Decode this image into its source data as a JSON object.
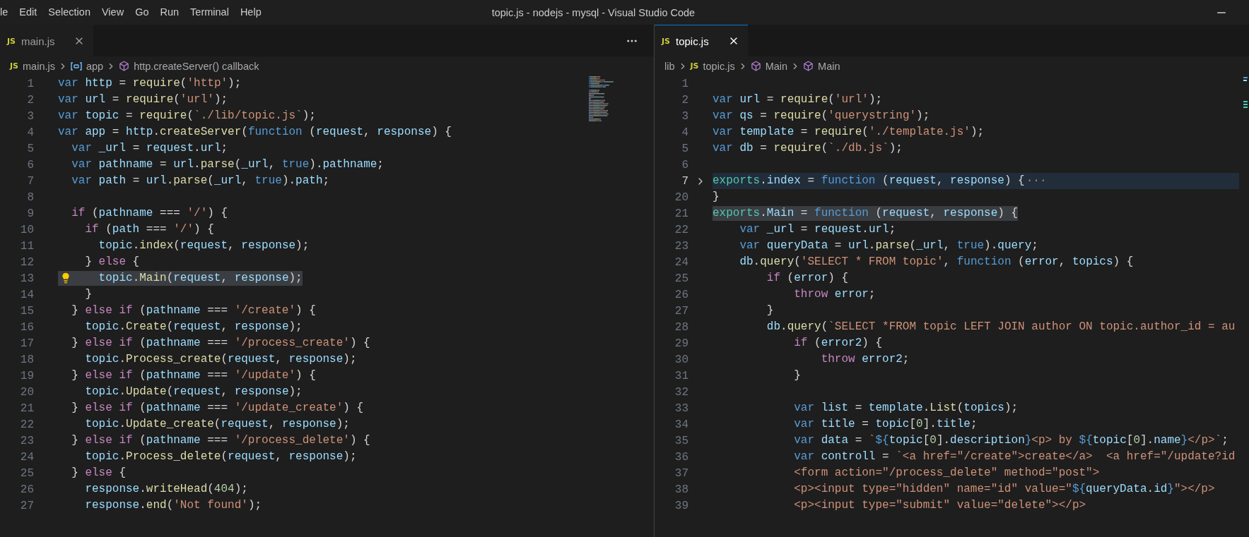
{
  "window": {
    "title": "topic.js - nodejs - mysql - Visual Studio Code"
  },
  "menu": [
    "le",
    "Edit",
    "Selection",
    "View",
    "Go",
    "Run",
    "Terminal",
    "Help"
  ],
  "panes": [
    {
      "focused": false,
      "more_actions": true,
      "tabs": [
        {
          "badge": "JS",
          "label": "main.js",
          "selected": true
        }
      ],
      "breadcrumbs": [
        {
          "kind": "file",
          "badge": "JS",
          "label": "main.js"
        },
        {
          "kind": "variable",
          "label": "app"
        },
        {
          "kind": "method",
          "label": "http.createServer() callback"
        }
      ],
      "minimap": true,
      "lines": [
        {
          "number": "1",
          "tokens": [
            {
              "kind": "keyword",
              "text": "var"
            },
            {
              "kind": "variable",
              "text": " http"
            },
            {
              "kind": "plain",
              "text": " = "
            },
            {
              "kind": "function",
              "text": "require"
            },
            {
              "kind": "plain",
              "text": "("
            },
            {
              "kind": "string",
              "text": "'http'"
            },
            {
              "kind": "plain",
              "text": ");"
            }
          ]
        },
        {
          "number": "2",
          "tokens": [
            {
              "kind": "keyword",
              "text": "var"
            },
            {
              "kind": "variable",
              "text": " url"
            },
            {
              "kind": "plain",
              "text": " = "
            },
            {
              "kind": "function",
              "text": "require"
            },
            {
              "kind": "plain",
              "text": "("
            },
            {
              "kind": "string",
              "text": "'url'"
            },
            {
              "kind": "plain",
              "text": ");"
            }
          ]
        },
        {
          "number": "3",
          "tokens": [
            {
              "kind": "keyword",
              "text": "var"
            },
            {
              "kind": "variable",
              "text": " topic"
            },
            {
              "kind": "plain",
              "text": " = "
            },
            {
              "kind": "function",
              "text": "require"
            },
            {
              "kind": "plain",
              "text": "("
            },
            {
              "kind": "string",
              "text": "`./lib/topic.js`"
            },
            {
              "kind": "plain",
              "text": ");"
            }
          ]
        },
        {
          "number": "4",
          "tokens": [
            {
              "kind": "keyword",
              "text": "var"
            },
            {
              "kind": "variable",
              "text": " app"
            },
            {
              "kind": "plain",
              "text": " = "
            },
            {
              "kind": "variable",
              "text": "http"
            },
            {
              "kind": "plain",
              "text": "."
            },
            {
              "kind": "function",
              "text": "createServer"
            },
            {
              "kind": "plain",
              "text": "("
            },
            {
              "kind": "keyword",
              "text": "function"
            },
            {
              "kind": "plain",
              "text": " ("
            },
            {
              "kind": "variable",
              "text": "request"
            },
            {
              "kind": "plain",
              "text": ", "
            },
            {
              "kind": "variable",
              "text": "response"
            },
            {
              "kind": "plain",
              "text": ") {"
            }
          ]
        },
        {
          "number": "5",
          "tokens": [
            {
              "kind": "keyword",
              "text": "  var"
            },
            {
              "kind": "variable",
              "text": " _url"
            },
            {
              "kind": "plain",
              "text": " = "
            },
            {
              "kind": "variable",
              "text": "request"
            },
            {
              "kind": "plain",
              "text": "."
            },
            {
              "kind": "variable",
              "text": "url"
            },
            {
              "kind": "plain",
              "text": ";"
            }
          ]
        },
        {
          "number": "6",
          "tokens": [
            {
              "kind": "keyword",
              "text": "  var"
            },
            {
              "kind": "variable",
              "text": " pathname"
            },
            {
              "kind": "plain",
              "text": " = "
            },
            {
              "kind": "variable",
              "text": "url"
            },
            {
              "kind": "plain",
              "text": "."
            },
            {
              "kind": "function",
              "text": "parse"
            },
            {
              "kind": "plain",
              "text": "("
            },
            {
              "kind": "variable",
              "text": "_url"
            },
            {
              "kind": "plain",
              "text": ", "
            },
            {
              "kind": "keyword",
              "text": "true"
            },
            {
              "kind": "plain",
              "text": ")."
            },
            {
              "kind": "variable",
              "text": "pathname"
            },
            {
              "kind": "plain",
              "text": ";"
            }
          ]
        },
        {
          "number": "7",
          "tokens": [
            {
              "kind": "keyword",
              "text": "  var"
            },
            {
              "kind": "variable",
              "text": " path"
            },
            {
              "kind": "plain",
              "text": " = "
            },
            {
              "kind": "variable",
              "text": "url"
            },
            {
              "kind": "plain",
              "text": "."
            },
            {
              "kind": "function",
              "text": "parse"
            },
            {
              "kind": "plain",
              "text": "("
            },
            {
              "kind": "variable",
              "text": "_url"
            },
            {
              "kind": "plain",
              "text": ", "
            },
            {
              "kind": "keyword",
              "text": "true"
            },
            {
              "kind": "plain",
              "text": ")."
            },
            {
              "kind": "variable",
              "text": "path"
            },
            {
              "kind": "plain",
              "text": ";"
            }
          ]
        },
        {
          "number": "8"
        },
        {
          "number": "9",
          "tokens": [
            {
              "kind": "control",
              "text": "  if"
            },
            {
              "kind": "plain",
              "text": " ("
            },
            {
              "kind": "variable",
              "text": "pathname"
            },
            {
              "kind": "plain",
              "text": " === "
            },
            {
              "kind": "string",
              "text": "'/'"
            },
            {
              "kind": "plain",
              "text": ") {"
            }
          ]
        },
        {
          "number": "10",
          "tokens": [
            {
              "kind": "control",
              "text": "    if"
            },
            {
              "kind": "plain",
              "text": " ("
            },
            {
              "kind": "variable",
              "text": "path"
            },
            {
              "kind": "plain",
              "text": " === "
            },
            {
              "kind": "string",
              "text": "'/'"
            },
            {
              "kind": "plain",
              "text": ") {"
            }
          ]
        },
        {
          "number": "11",
          "tokens": [
            {
              "kind": "variable",
              "text": "      topic"
            },
            {
              "kind": "plain",
              "text": "."
            },
            {
              "kind": "function",
              "text": "index"
            },
            {
              "kind": "plain",
              "text": "("
            },
            {
              "kind": "variable",
              "text": "request"
            },
            {
              "kind": "plain",
              "text": ", "
            },
            {
              "kind": "variable",
              "text": "response"
            },
            {
              "kind": "plain",
              "text": ");"
            }
          ]
        },
        {
          "number": "12",
          "tokens": [
            {
              "kind": "plain",
              "text": "    } "
            },
            {
              "kind": "control",
              "text": "else"
            },
            {
              "kind": "plain",
              "text": " {"
            }
          ]
        },
        {
          "number": "13",
          "selected_text": true,
          "lightbulb": true,
          "tokens": [
            {
              "kind": "variable",
              "text": "      topic"
            },
            {
              "kind": "plain",
              "text": "."
            },
            {
              "kind": "function",
              "text": "Main"
            },
            {
              "kind": "plain",
              "text": "("
            },
            {
              "kind": "variable",
              "text": "request"
            },
            {
              "kind": "plain",
              "text": ", "
            },
            {
              "kind": "variable",
              "text": "response"
            },
            {
              "kind": "plain",
              "text": ");"
            }
          ]
        },
        {
          "number": "14",
          "tokens": [
            {
              "kind": "plain",
              "text": "    }"
            }
          ]
        },
        {
          "number": "15",
          "tokens": [
            {
              "kind": "plain",
              "text": "  } "
            },
            {
              "kind": "control",
              "text": "else if"
            },
            {
              "kind": "plain",
              "text": " ("
            },
            {
              "kind": "variable",
              "text": "pathname"
            },
            {
              "kind": "plain",
              "text": " === "
            },
            {
              "kind": "string",
              "text": "'/create'"
            },
            {
              "kind": "plain",
              "text": ") {"
            }
          ]
        },
        {
          "number": "16",
          "tokens": [
            {
              "kind": "variable",
              "text": "    topic"
            },
            {
              "kind": "plain",
              "text": "."
            },
            {
              "kind": "function",
              "text": "Create"
            },
            {
              "kind": "plain",
              "text": "("
            },
            {
              "kind": "variable",
              "text": "request"
            },
            {
              "kind": "plain",
              "text": ", "
            },
            {
              "kind": "variable",
              "text": "response"
            },
            {
              "kind": "plain",
              "text": ");"
            }
          ]
        },
        {
          "number": "17",
          "tokens": [
            {
              "kind": "plain",
              "text": "  } "
            },
            {
              "kind": "control",
              "text": "else if"
            },
            {
              "kind": "plain",
              "text": " ("
            },
            {
              "kind": "variable",
              "text": "pathname"
            },
            {
              "kind": "plain",
              "text": " === "
            },
            {
              "kind": "string",
              "text": "'/process_create'"
            },
            {
              "kind": "plain",
              "text": ") {"
            }
          ]
        },
        {
          "number": "18",
          "tokens": [
            {
              "kind": "variable",
              "text": "    topic"
            },
            {
              "kind": "plain",
              "text": "."
            },
            {
              "kind": "function",
              "text": "Process_create"
            },
            {
              "kind": "plain",
              "text": "("
            },
            {
              "kind": "variable",
              "text": "request"
            },
            {
              "kind": "plain",
              "text": ", "
            },
            {
              "kind": "variable",
              "text": "response"
            },
            {
              "kind": "plain",
              "text": ");"
            }
          ]
        },
        {
          "number": "19",
          "tokens": [
            {
              "kind": "plain",
              "text": "  } "
            },
            {
              "kind": "control",
              "text": "else if"
            },
            {
              "kind": "plain",
              "text": " ("
            },
            {
              "kind": "variable",
              "text": "pathname"
            },
            {
              "kind": "plain",
              "text": " === "
            },
            {
              "kind": "string",
              "text": "'/update'"
            },
            {
              "kind": "plain",
              "text": ") {"
            }
          ]
        },
        {
          "number": "20",
          "tokens": [
            {
              "kind": "variable",
              "text": "    topic"
            },
            {
              "kind": "plain",
              "text": "."
            },
            {
              "kind": "function",
              "text": "Update"
            },
            {
              "kind": "plain",
              "text": "("
            },
            {
              "kind": "variable",
              "text": "request"
            },
            {
              "kind": "plain",
              "text": ", "
            },
            {
              "kind": "variable",
              "text": "response"
            },
            {
              "kind": "plain",
              "text": ");"
            }
          ]
        },
        {
          "number": "21",
          "tokens": [
            {
              "kind": "plain",
              "text": "  } "
            },
            {
              "kind": "control",
              "text": "else if"
            },
            {
              "kind": "plain",
              "text": " ("
            },
            {
              "kind": "variable",
              "text": "pathname"
            },
            {
              "kind": "plain",
              "text": " === "
            },
            {
              "kind": "string",
              "text": "'/update_create'"
            },
            {
              "kind": "plain",
              "text": ") {"
            }
          ]
        },
        {
          "number": "22",
          "tokens": [
            {
              "kind": "variable",
              "text": "    topic"
            },
            {
              "kind": "plain",
              "text": "."
            },
            {
              "kind": "function",
              "text": "Update_create"
            },
            {
              "kind": "plain",
              "text": "("
            },
            {
              "kind": "variable",
              "text": "request"
            },
            {
              "kind": "plain",
              "text": ", "
            },
            {
              "kind": "variable",
              "text": "response"
            },
            {
              "kind": "plain",
              "text": ");"
            }
          ]
        },
        {
          "number": "23",
          "tokens": [
            {
              "kind": "plain",
              "text": "  } "
            },
            {
              "kind": "control",
              "text": "else if"
            },
            {
              "kind": "plain",
              "text": " ("
            },
            {
              "kind": "variable",
              "text": "pathname"
            },
            {
              "kind": "plain",
              "text": " === "
            },
            {
              "kind": "string",
              "text": "'/process_delete'"
            },
            {
              "kind": "plain",
              "text": ") {"
            }
          ]
        },
        {
          "number": "24",
          "tokens": [
            {
              "kind": "variable",
              "text": "    topic"
            },
            {
              "kind": "plain",
              "text": "."
            },
            {
              "kind": "function",
              "text": "Process_delete"
            },
            {
              "kind": "plain",
              "text": "("
            },
            {
              "kind": "variable",
              "text": "request"
            },
            {
              "kind": "plain",
              "text": ", "
            },
            {
              "kind": "variable",
              "text": "response"
            },
            {
              "kind": "plain",
              "text": ");"
            }
          ]
        },
        {
          "number": "25",
          "tokens": [
            {
              "kind": "plain",
              "text": "  } "
            },
            {
              "kind": "control",
              "text": "else"
            },
            {
              "kind": "plain",
              "text": " {"
            }
          ]
        },
        {
          "number": "26",
          "tokens": [
            {
              "kind": "variable",
              "text": "    response"
            },
            {
              "kind": "plain",
              "text": "."
            },
            {
              "kind": "function",
              "text": "writeHead"
            },
            {
              "kind": "plain",
              "text": "("
            },
            {
              "kind": "number",
              "text": "404"
            },
            {
              "kind": "plain",
              "text": ");"
            }
          ]
        },
        {
          "number": "27",
          "tokens": [
            {
              "kind": "variable",
              "text": "    response"
            },
            {
              "kind": "plain",
              "text": "."
            },
            {
              "kind": "function",
              "text": "end"
            },
            {
              "kind": "plain",
              "text": "("
            },
            {
              "kind": "string",
              "text": "'Not found'"
            },
            {
              "kind": "plain",
              "text": ");"
            }
          ]
        }
      ]
    },
    {
      "focused": true,
      "tabs": [
        {
          "badge": "JS",
          "label": "topic.js",
          "selected": true
        }
      ],
      "breadcrumbs": [
        {
          "kind": "folder",
          "label": "lib"
        },
        {
          "kind": "file",
          "badge": "JS",
          "label": "topic.js"
        },
        {
          "kind": "method",
          "label": "Main"
        },
        {
          "kind": "method",
          "label": "Main"
        }
      ],
      "lines": [
        {
          "number": "1"
        },
        {
          "number": "2",
          "tokens": [
            {
              "kind": "keyword",
              "text": "var"
            },
            {
              "kind": "variable",
              "text": " url"
            },
            {
              "kind": "plain",
              "text": " = "
            },
            {
              "kind": "function",
              "text": "require"
            },
            {
              "kind": "plain",
              "text": "("
            },
            {
              "kind": "string",
              "text": "'url'"
            },
            {
              "kind": "plain",
              "text": ");"
            }
          ]
        },
        {
          "number": "3",
          "tokens": [
            {
              "kind": "keyword",
              "text": "var"
            },
            {
              "kind": "variable",
              "text": " qs"
            },
            {
              "kind": "plain",
              "text": " = "
            },
            {
              "kind": "function",
              "text": "require"
            },
            {
              "kind": "plain",
              "text": "("
            },
            {
              "kind": "string",
              "text": "'querystring'"
            },
            {
              "kind": "plain",
              "text": ");"
            }
          ]
        },
        {
          "number": "4",
          "tokens": [
            {
              "kind": "keyword",
              "text": "var"
            },
            {
              "kind": "variable",
              "text": " template"
            },
            {
              "kind": "plain",
              "text": " = "
            },
            {
              "kind": "function",
              "text": "require"
            },
            {
              "kind": "plain",
              "text": "("
            },
            {
              "kind": "string",
              "text": "'./template.js'"
            },
            {
              "kind": "plain",
              "text": ");"
            }
          ]
        },
        {
          "number": "5",
          "tokens": [
            {
              "kind": "keyword",
              "text": "var"
            },
            {
              "kind": "variable",
              "text": " db"
            },
            {
              "kind": "plain",
              "text": " = "
            },
            {
              "kind": "function",
              "text": "require"
            },
            {
              "kind": "plain",
              "text": "("
            },
            {
              "kind": "string",
              "text": "`./db.js`"
            },
            {
              "kind": "plain",
              "text": ");"
            }
          ]
        },
        {
          "number": "6"
        },
        {
          "number": "7",
          "current_line": true,
          "folded": true,
          "fold_ellipsis": "···",
          "tokens": [
            {
              "kind": "type",
              "text": "exports"
            },
            {
              "kind": "plain",
              "text": "."
            },
            {
              "kind": "variable",
              "text": "index"
            },
            {
              "kind": "plain",
              "text": " = "
            },
            {
              "kind": "keyword",
              "text": "function"
            },
            {
              "kind": "plain",
              "text": " ("
            },
            {
              "kind": "variable",
              "text": "request"
            },
            {
              "kind": "plain",
              "text": ", "
            },
            {
              "kind": "variable",
              "text": "response"
            },
            {
              "kind": "plain",
              "text": ") {"
            }
          ]
        },
        {
          "number": "20",
          "tokens": [
            {
              "kind": "plain",
              "text": "}"
            }
          ]
        },
        {
          "number": "21",
          "selected_text": true,
          "tokens": [
            {
              "kind": "type",
              "text": "exports"
            },
            {
              "kind": "plain",
              "text": "."
            },
            {
              "kind": "variable",
              "text": "Main"
            },
            {
              "kind": "plain",
              "text": " = "
            },
            {
              "kind": "keyword",
              "text": "function"
            },
            {
              "kind": "plain",
              "text": " ("
            },
            {
              "kind": "variable",
              "text": "request"
            },
            {
              "kind": "plain",
              "text": ", "
            },
            {
              "kind": "variable",
              "text": "response"
            },
            {
              "kind": "plain",
              "text": ") {"
            }
          ]
        },
        {
          "number": "22",
          "tokens": [
            {
              "kind": "keyword",
              "text": "    var"
            },
            {
              "kind": "variable",
              "text": " _url"
            },
            {
              "kind": "plain",
              "text": " = "
            },
            {
              "kind": "variable",
              "text": "request"
            },
            {
              "kind": "plain",
              "text": "."
            },
            {
              "kind": "variable",
              "text": "url"
            },
            {
              "kind": "plain",
              "text": ";"
            }
          ]
        },
        {
          "number": "23",
          "tokens": [
            {
              "kind": "keyword",
              "text": "    var"
            },
            {
              "kind": "variable",
              "text": " queryData"
            },
            {
              "kind": "plain",
              "text": " = "
            },
            {
              "kind": "variable",
              "text": "url"
            },
            {
              "kind": "plain",
              "text": "."
            },
            {
              "kind": "function",
              "text": "parse"
            },
            {
              "kind": "plain",
              "text": "("
            },
            {
              "kind": "variable",
              "text": "_url"
            },
            {
              "kind": "plain",
              "text": ", "
            },
            {
              "kind": "keyword",
              "text": "true"
            },
            {
              "kind": "plain",
              "text": ")."
            },
            {
              "kind": "variable",
              "text": "query"
            },
            {
              "kind": "plain",
              "text": ";"
            }
          ]
        },
        {
          "number": "24",
          "tokens": [
            {
              "kind": "variable",
              "text": "    db"
            },
            {
              "kind": "plain",
              "text": "."
            },
            {
              "kind": "function",
              "text": "query"
            },
            {
              "kind": "plain",
              "text": "("
            },
            {
              "kind": "string",
              "text": "'SELECT * FROM topic'"
            },
            {
              "kind": "plain",
              "text": ", "
            },
            {
              "kind": "keyword",
              "text": "function"
            },
            {
              "kind": "plain",
              "text": " ("
            },
            {
              "kind": "variable",
              "text": "error"
            },
            {
              "kind": "plain",
              "text": ", "
            },
            {
              "kind": "variable",
              "text": "topics"
            },
            {
              "kind": "plain",
              "text": ") {"
            }
          ]
        },
        {
          "number": "25",
          "tokens": [
            {
              "kind": "control",
              "text": "        if"
            },
            {
              "kind": "plain",
              "text": " ("
            },
            {
              "kind": "variable",
              "text": "error"
            },
            {
              "kind": "plain",
              "text": ") {"
            }
          ]
        },
        {
          "number": "26",
          "tokens": [
            {
              "kind": "control",
              "text": "            throw"
            },
            {
              "kind": "variable",
              "text": " error"
            },
            {
              "kind": "plain",
              "text": ";"
            }
          ]
        },
        {
          "number": "27",
          "tokens": [
            {
              "kind": "plain",
              "text": "        }"
            }
          ]
        },
        {
          "number": "28",
          "tokens": [
            {
              "kind": "variable",
              "text": "        db"
            },
            {
              "kind": "plain",
              "text": "."
            },
            {
              "kind": "function",
              "text": "query"
            },
            {
              "kind": "plain",
              "text": "("
            },
            {
              "kind": "string",
              "text": "`SELECT *FROM topic LEFT JOIN author ON topic.author_id = au"
            }
          ]
        },
        {
          "number": "29",
          "tokens": [
            {
              "kind": "control",
              "text": "            if"
            },
            {
              "kind": "plain",
              "text": " ("
            },
            {
              "kind": "variable",
              "text": "error2"
            },
            {
              "kind": "plain",
              "text": ") {"
            }
          ]
        },
        {
          "number": "30",
          "tokens": [
            {
              "kind": "control",
              "text": "                throw"
            },
            {
              "kind": "variable",
              "text": " error2"
            },
            {
              "kind": "plain",
              "text": ";"
            }
          ]
        },
        {
          "number": "31",
          "tokens": [
            {
              "kind": "plain",
              "text": "            }"
            }
          ]
        },
        {
          "number": "32"
        },
        {
          "number": "33",
          "tokens": [
            {
              "kind": "keyword",
              "text": "            var"
            },
            {
              "kind": "variable",
              "text": " list"
            },
            {
              "kind": "plain",
              "text": " = "
            },
            {
              "kind": "variable",
              "text": "template"
            },
            {
              "kind": "plain",
              "text": "."
            },
            {
              "kind": "function",
              "text": "List"
            },
            {
              "kind": "plain",
              "text": "("
            },
            {
              "kind": "variable",
              "text": "topics"
            },
            {
              "kind": "plain",
              "text": ");"
            }
          ]
        },
        {
          "number": "34",
          "tokens": [
            {
              "kind": "keyword",
              "text": "            var"
            },
            {
              "kind": "variable",
              "text": " title"
            },
            {
              "kind": "plain",
              "text": " = "
            },
            {
              "kind": "variable",
              "text": "topic"
            },
            {
              "kind": "plain",
              "text": "["
            },
            {
              "kind": "number",
              "text": "0"
            },
            {
              "kind": "plain",
              "text": "]."
            },
            {
              "kind": "variable",
              "text": "title"
            },
            {
              "kind": "plain",
              "text": ";"
            }
          ]
        },
        {
          "number": "35",
          "tokens": [
            {
              "kind": "keyword",
              "text": "            var"
            },
            {
              "kind": "variable",
              "text": " data"
            },
            {
              "kind": "plain",
              "text": " = "
            },
            {
              "kind": "string",
              "text": "`"
            },
            {
              "kind": "keyword",
              "text": "${"
            },
            {
              "kind": "variable",
              "text": "topic"
            },
            {
              "kind": "plain",
              "text": "["
            },
            {
              "kind": "number",
              "text": "0"
            },
            {
              "kind": "plain",
              "text": "]."
            },
            {
              "kind": "variable",
              "text": "description"
            },
            {
              "kind": "keyword",
              "text": "}"
            },
            {
              "kind": "string",
              "text": "<p> by "
            },
            {
              "kind": "keyword",
              "text": "${"
            },
            {
              "kind": "variable",
              "text": "topic"
            },
            {
              "kind": "plain",
              "text": "["
            },
            {
              "kind": "number",
              "text": "0"
            },
            {
              "kind": "plain",
              "text": "]."
            },
            {
              "kind": "variable",
              "text": "name"
            },
            {
              "kind": "keyword",
              "text": "}"
            },
            {
              "kind": "string",
              "text": "</p>`"
            },
            {
              "kind": "plain",
              "text": ";"
            }
          ]
        },
        {
          "number": "36",
          "tokens": [
            {
              "kind": "keyword",
              "text": "            var"
            },
            {
              "kind": "variable",
              "text": " controll"
            },
            {
              "kind": "plain",
              "text": " = "
            },
            {
              "kind": "string",
              "text": "`<a href=\"/create\">create</a>  <a href=\"/update?id"
            }
          ]
        },
        {
          "number": "37",
          "tokens": [
            {
              "kind": "string",
              "text": "            <form action=\"/process_delete\" method=\"post\">"
            }
          ]
        },
        {
          "number": "38",
          "tokens": [
            {
              "kind": "string",
              "text": "            <p><input type=\"hidden\" name=\"id\" value=\""
            },
            {
              "kind": "keyword",
              "text": "${"
            },
            {
              "kind": "variable",
              "text": "queryData"
            },
            {
              "kind": "plain",
              "text": "."
            },
            {
              "kind": "variable",
              "text": "id"
            },
            {
              "kind": "keyword",
              "text": "}"
            },
            {
              "kind": "string",
              "text": "\"></p>"
            }
          ]
        },
        {
          "number": "39",
          "tokens": [
            {
              "kind": "string",
              "text": "            <p><input type=\"submit\" value=\"delete\"></p>"
            }
          ]
        }
      ]
    }
  ]
}
